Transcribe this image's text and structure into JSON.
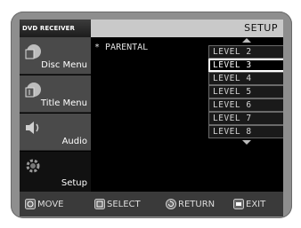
{
  "header": {
    "brand": "DVD RECEIVER",
    "title": "SETUP"
  },
  "sidebar": {
    "items": [
      {
        "label": "Disc Menu",
        "icon": "disc-menu-icon"
      },
      {
        "label": "Title Menu",
        "icon": "title-menu-icon"
      },
      {
        "label": "Audio",
        "icon": "speaker-icon"
      },
      {
        "label": "Setup",
        "icon": "gear-icon",
        "active": true
      }
    ]
  },
  "main": {
    "parameter_label": "* PARENTAL",
    "options": [
      "LEVEL 2",
      "LEVEL 3",
      "LEVEL 4",
      "LEVEL 5",
      "LEVEL 6",
      "LEVEL 7",
      "LEVEL 8"
    ],
    "selected": "LEVEL 3"
  },
  "footer": {
    "move": "MOVE",
    "select": "SELECT",
    "return": "RETURN",
    "exit": "EXIT"
  },
  "colors": {
    "bezel": "#8e8e8e",
    "header_bar": "#c9c9c9",
    "sidebar": "#4a4a4a",
    "screen": "#000000"
  }
}
